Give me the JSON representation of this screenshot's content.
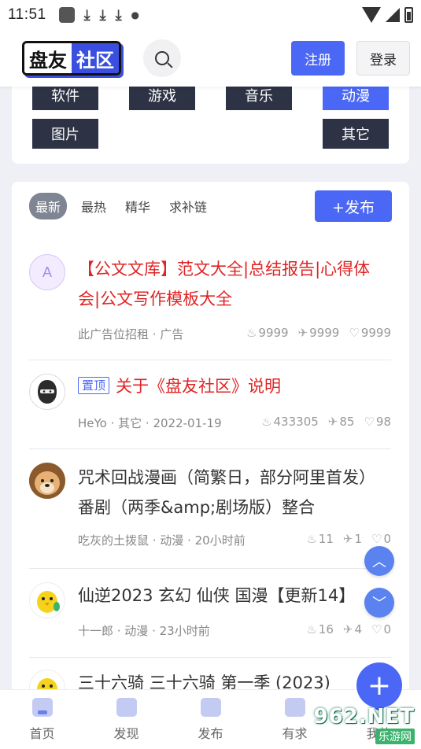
{
  "status_bar": {
    "time": "11:51"
  },
  "header": {
    "logo_part1": "盘友",
    "logo_part2": "社区",
    "register_label": "注册",
    "login_label": "登录"
  },
  "categories": [
    {
      "label": "软件",
      "active": false
    },
    {
      "label": "游戏",
      "active": false
    },
    {
      "label": "音乐",
      "active": false
    },
    {
      "label": "动漫",
      "active": true
    },
    {
      "label": "图片",
      "active": false
    },
    {
      "label": "其它",
      "active": false
    }
  ],
  "feed": {
    "tabs": [
      "最新",
      "最热",
      "精华",
      "求补链"
    ],
    "active_tab": "最新",
    "publish_label": "+发布",
    "posts": [
      {
        "avatar_letter": "A",
        "title": "【公文文库】范文大全|总结报告|心得体会|公文写作模板大全",
        "meta": "此广告位招租 · 广告",
        "views": "9999",
        "shares": "9999",
        "likes": "9999"
      },
      {
        "pin_label": "置顶",
        "title": "关于《盘友社区》说明",
        "meta": "HeYo · 其它 · 2022-01-19",
        "views": "433305",
        "shares": "85",
        "likes": "98"
      },
      {
        "title": "咒术回战漫画（简繁日，部分阿里首发）番剧（两季&amp;剧场版）整合",
        "meta": "吃灰的土拨鼠 · 动漫 · 20小时前",
        "views": "11",
        "shares": "1",
        "likes": "0"
      },
      {
        "title": "仙逆2023 玄幻 仙侠 国漫【更新14】",
        "meta": "十一郎 · 动漫 · 23小时前",
        "views": "16",
        "shares": "4",
        "likes": "0"
      },
      {
        "title": "三十六骑 三十六骑 第一季 (2023)"
      }
    ]
  },
  "bottom_nav": [
    "首页",
    "发现",
    "发布",
    "有求",
    "我的"
  ],
  "watermark": {
    "main": "962.NET",
    "sub": "乐游网"
  },
  "colors": {
    "accent": "#4a68f5",
    "category_bg": "#2d3345",
    "red_title": "#e02424"
  }
}
